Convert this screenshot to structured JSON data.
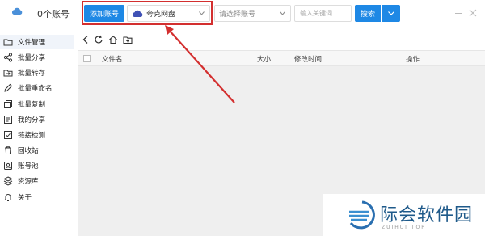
{
  "header": {
    "account_count": "0个账号",
    "add_account": "添加账号",
    "cloud_select": "夸克网盘",
    "account_placeholder": "请选择账号",
    "keyword_placeholder": "输入关键词",
    "search": "搜索"
  },
  "sidebar": {
    "items": [
      {
        "label": "文件管理",
        "icon": "folder-icon"
      },
      {
        "label": "批量分享",
        "icon": "share-icon"
      },
      {
        "label": "批量转存",
        "icon": "transfer-icon"
      },
      {
        "label": "批量重命名",
        "icon": "rename-icon"
      },
      {
        "label": "批量复制",
        "icon": "copy-icon"
      },
      {
        "label": "我的分享",
        "icon": "my-share-icon"
      },
      {
        "label": "链接检测",
        "icon": "link-check-icon"
      },
      {
        "label": "回收站",
        "icon": "trash-icon"
      },
      {
        "label": "账号池",
        "icon": "account-pool-icon"
      },
      {
        "label": "资源库",
        "icon": "library-icon"
      },
      {
        "label": "关于",
        "icon": "bell-icon"
      }
    ]
  },
  "table": {
    "columns": [
      "文件名",
      "大小",
      "修改时间",
      "操作"
    ]
  },
  "watermark": {
    "text": "际会软件园",
    "subtext": "ZUIHUI TOP"
  },
  "colors": {
    "accent": "#1e88e5",
    "highlight": "#d32f2f"
  }
}
